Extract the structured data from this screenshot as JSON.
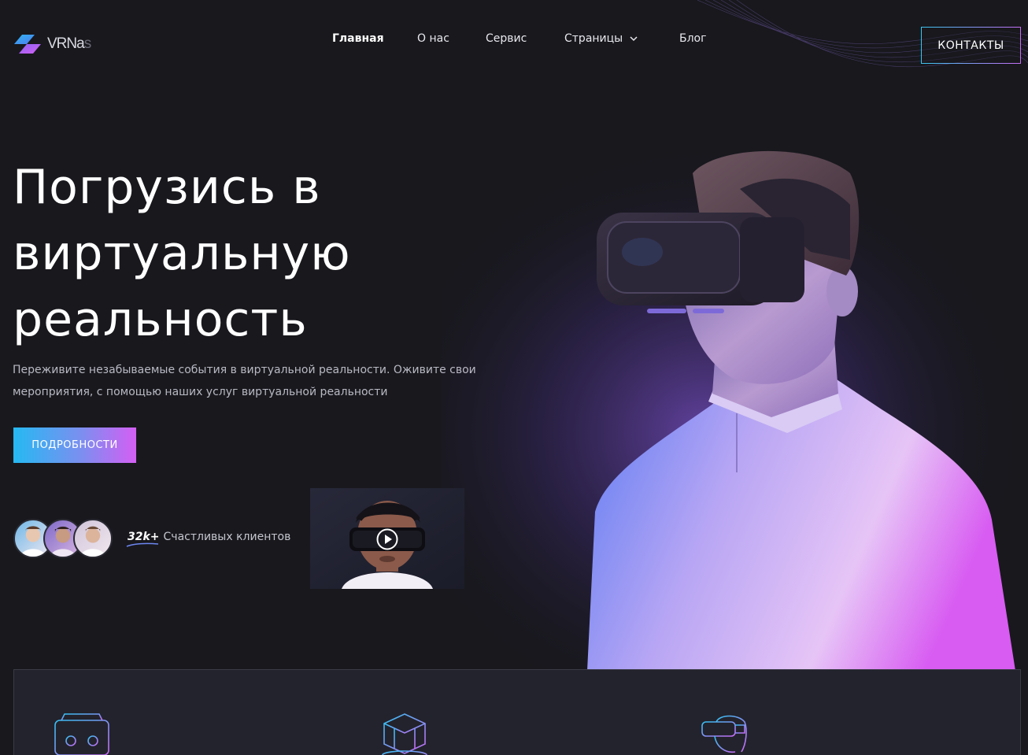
{
  "brand": {
    "logo_text": "VRNas",
    "logo_text_strong": "VRNa",
    "logo_text_fade": "s"
  },
  "nav": {
    "items": [
      {
        "label": "Главная",
        "active": true
      },
      {
        "label": "О нас",
        "active": false
      },
      {
        "label": "Сервис",
        "active": false
      },
      {
        "label": "Страницы",
        "active": false,
        "has_dropdown": true
      },
      {
        "label": "Блог",
        "active": false
      }
    ]
  },
  "contact_button": {
    "label": "КОНТАКТЫ"
  },
  "hero": {
    "title_lines": [
      "Погрузись в",
      "виртуальную",
      "реальность"
    ],
    "description_lines": [
      "Переживите незабываемые события в виртуальной реальности. Оживите свои",
      "мероприятия, с помощью наших услуг виртуальной реальности"
    ],
    "cta_label": "ПОДРОБНОСТИ",
    "clients_count": "32k+",
    "clients_label": "Счастливых клиентов"
  },
  "icons": {
    "logo": "logo-mark-icon",
    "dropdown": "chevron-down-icon",
    "play": "play-icon",
    "feature_1": "vr-headset-icon",
    "feature_2": "vr-cube-icon",
    "feature_3": "vr-person-icon"
  },
  "colors": {
    "background": "#18181d",
    "accent_cyan": "#25b9f2",
    "accent_purple": "#d45ff3",
    "panel": "#23232d"
  }
}
